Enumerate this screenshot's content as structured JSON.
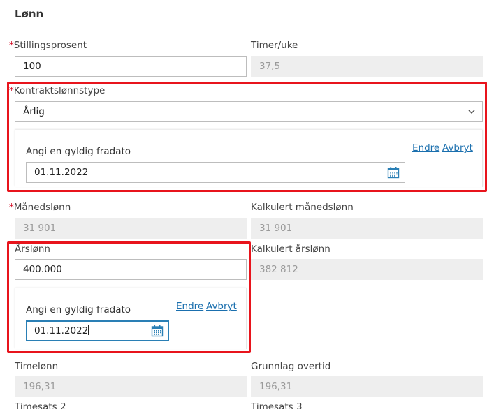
{
  "section": {
    "title": "Lønn"
  },
  "fields": {
    "stillingsprosent": {
      "label": "Stillingsprosent",
      "required": "*",
      "value": "100"
    },
    "timer_uke": {
      "label": "Timer/uke",
      "value": "37,5"
    },
    "kontraktslonnstype": {
      "label": "Kontraktslønnstype",
      "required": "*",
      "value": "Årlig"
    },
    "kontrakt_fradato": {
      "label": "Angi en gyldig fradato",
      "value": "01.11.2022",
      "change_link": "Endre",
      "cancel_link": "Avbryt"
    },
    "manedslonn": {
      "label": "Månedslønn",
      "required": "*",
      "value": "31 901"
    },
    "kalkulert_manedslonn": {
      "label": "Kalkulert månedslønn",
      "value": "31 901"
    },
    "arslonn": {
      "label": "Årslønn",
      "value": "400.000"
    },
    "kalkulert_arslonn": {
      "label": "Kalkulert årslønn",
      "value": "382 812"
    },
    "arslonn_fradato": {
      "label": "Angi en gyldig fradato",
      "value": "01.11.2022",
      "change_link": "Endre",
      "cancel_link": "Avbryt"
    },
    "timelonn": {
      "label": "Timelønn",
      "value": "196,31"
    },
    "grunnlag_overtid": {
      "label": "Grunnlag overtid",
      "value": "196,31"
    },
    "timesats2": {
      "label": "Timesats 2"
    },
    "timesats3": {
      "label": "Timesats 3"
    }
  },
  "icons": {
    "dropdown": "chevron-down-icon",
    "calendar": "calendar-icon"
  },
  "colors": {
    "highlight": "#e8141c",
    "link": "#1a6fae",
    "focus": "#2a7fb5",
    "required": "#d0021b"
  }
}
